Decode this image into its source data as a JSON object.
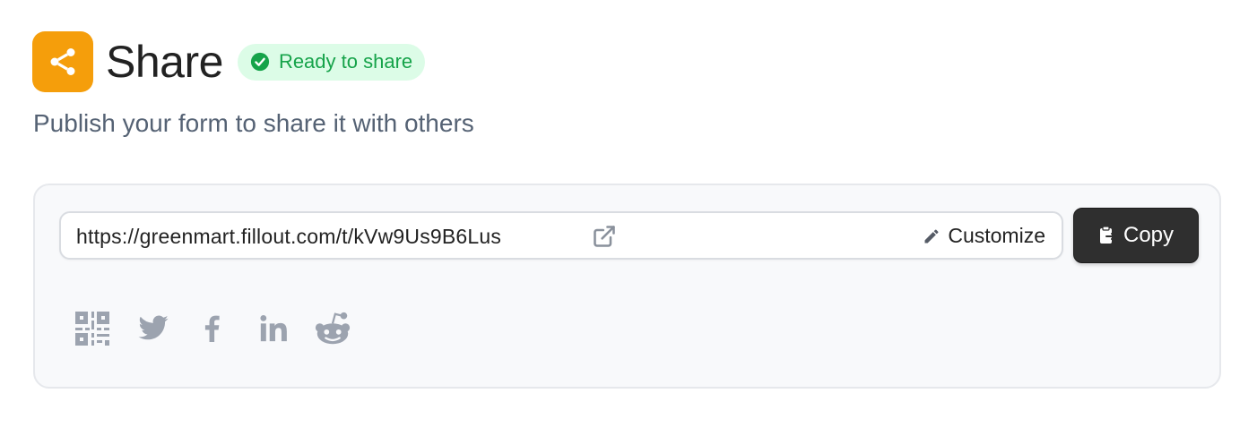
{
  "header": {
    "icon": "share-icon",
    "title": "Share",
    "badge": {
      "icon": "check-circle-icon",
      "label": "Ready to share"
    }
  },
  "subtitle": "Publish your form to share it with others",
  "share_link": {
    "url": "https://greenmart.fillout.com/t/kVw9Us9B6Lus",
    "open_icon": "external-link-icon",
    "customize_icon": "pencil-icon",
    "customize_label": "Customize",
    "copy_icon": "clipboard-icon",
    "copy_label": "Copy"
  },
  "social_options": [
    {
      "icon": "qr-code-icon"
    },
    {
      "icon": "twitter-icon"
    },
    {
      "icon": "facebook-icon"
    },
    {
      "icon": "linkedin-icon"
    },
    {
      "icon": "reddit-icon"
    }
  ],
  "colors": {
    "accent": "#f59e0b",
    "badge_bg": "#dcfce7",
    "badge_text": "#16a34a",
    "copy_button_bg": "#2f2f2f",
    "social_icon": "#9ca3af"
  }
}
